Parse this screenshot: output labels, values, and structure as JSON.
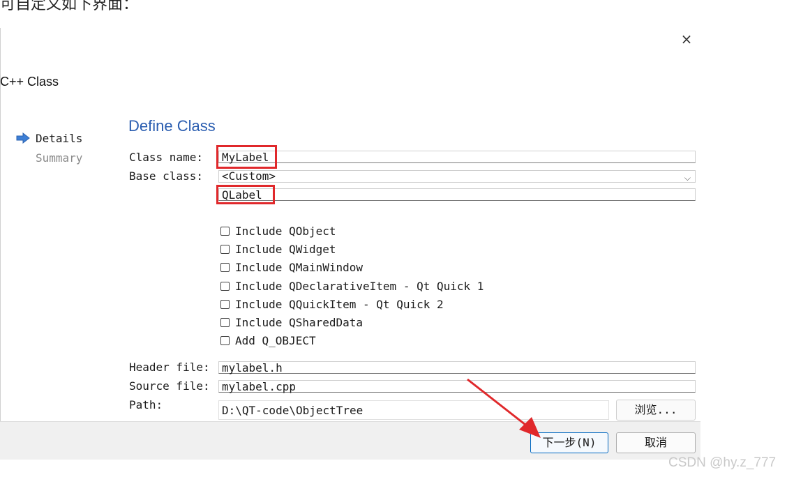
{
  "top_caption": "可自定义如下界面：",
  "dialog": {
    "title": "C++ Class",
    "close_glyph": "×"
  },
  "steps": [
    {
      "label": "Details",
      "current": true
    },
    {
      "label": "Summary",
      "current": false
    }
  ],
  "page": {
    "title": "Define Class",
    "class_name_label": "Class name:",
    "class_name_value": "MyLabel",
    "base_class_label": "Base class:",
    "base_class_value": "<Custom>",
    "custom_base_value": "QLabel",
    "checkboxes": [
      {
        "label": "Include QObject",
        "checked": false
      },
      {
        "label": "Include QWidget",
        "checked": false
      },
      {
        "label": "Include QMainWindow",
        "checked": false
      },
      {
        "label": "Include QDeclarativeItem - Qt Quick 1",
        "checked": false
      },
      {
        "label": "Include QQuickItem - Qt Quick 2",
        "checked": false
      },
      {
        "label": "Include QSharedData",
        "checked": false
      },
      {
        "label": "Add Q_OBJECT",
        "checked": false
      }
    ],
    "header_file_label": "Header file:",
    "header_file_value": "mylabel.h",
    "source_file_label": "Source file:",
    "source_file_value": "mylabel.cpp",
    "path_label": "Path:",
    "path_value": "D:\\QT-code\\ObjectTree",
    "browse_label": "浏览..."
  },
  "footer": {
    "next_label": "下一步(N)",
    "cancel_label": "取消"
  },
  "watermark": "CSDN @hy.z_777",
  "colors": {
    "accent_title": "#2a5db0",
    "highlight": "#e0282b",
    "step_arrow": "#3d7fd6"
  }
}
